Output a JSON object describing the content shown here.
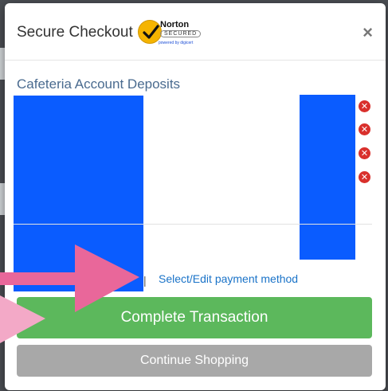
{
  "modal": {
    "title": "Secure Checkout",
    "close_label": "×",
    "norton_badge": {
      "brand": "Norton",
      "secured": "SECURED",
      "powered": "powered by digicert"
    }
  },
  "section": {
    "title": "Cafeteria Account Deposits"
  },
  "remove_icon_glyph": "✕",
  "payment": {
    "separator": "|",
    "link_label": "Select/Edit payment method"
  },
  "buttons": {
    "complete_label": "Complete Transaction",
    "continue_label": "Continue Shopping"
  },
  "colors": {
    "complete_button": "#5cb85c",
    "continue_button": "#a8a8a8",
    "link": "#1a73c8",
    "remove_icon": "#d9302c",
    "redaction": "#0a5cff",
    "arrow_dark": "#e9679a",
    "arrow_light": "#f3a9c7"
  }
}
